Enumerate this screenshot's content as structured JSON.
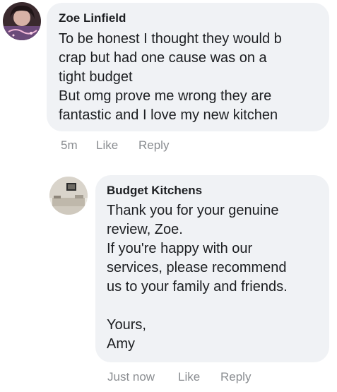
{
  "comments": [
    {
      "author": "Zoe Linfield",
      "lines": [
        "To be honest I thought they would b",
        "crap but had one cause was on a",
        "tight budget",
        "But omg prove me wrong they are",
        "fantastic and I love my new kitchen"
      ],
      "time": "5m",
      "like_label": "Like",
      "reply_label": "Reply"
    },
    {
      "author": "Budget Kitchens",
      "lines": [
        "Thank you for your genuine",
        "review, Zoe.",
        "If you're happy with our",
        "services, please recommend",
        "us to your family and friends.",
        "",
        "Yours,",
        "Amy"
      ],
      "time": "Just now",
      "like_label": "Like",
      "reply_label": "Reply"
    }
  ]
}
